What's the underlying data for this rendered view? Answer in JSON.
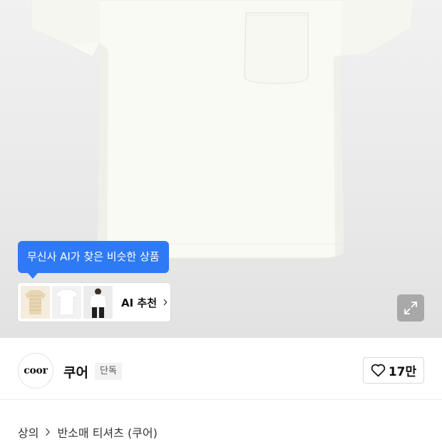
{
  "product_image": {
    "alt_icon": "tshirt-photo"
  },
  "ai_tooltip": {
    "text": "무신사 AI가 찾은 비슷한 상품"
  },
  "ai_recommend": {
    "label": "AI 추천",
    "thumbnails": [
      "beige-striped-tshirt",
      "white-tshirt-flat",
      "white-tshirt-model"
    ]
  },
  "expand_icon": "expand-icon",
  "brand": {
    "logo_text": "coor",
    "name": "쿠어",
    "badge": "단독"
  },
  "like": {
    "count": "17만",
    "icon": "heart-icon"
  },
  "breadcrumb": {
    "items": [
      "상의",
      "반소매 티셔츠 (쿠어)"
    ]
  },
  "colors": {
    "accent": "#2e7af5",
    "hero_bg": "#ececec"
  }
}
